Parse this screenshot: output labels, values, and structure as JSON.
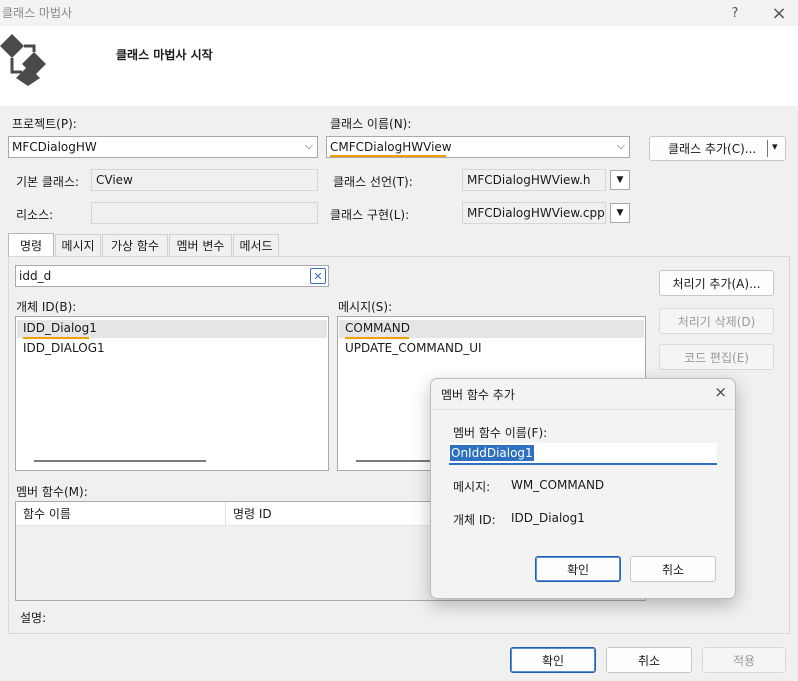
{
  "window": {
    "title": "클래스 마법사",
    "help": "?",
    "close": "×"
  },
  "banner": {
    "heading": "클래스 마법사 시작"
  },
  "project": {
    "label": "프로젝트(P):",
    "value": "MFCDialogHW"
  },
  "class_name": {
    "label": "클래스 이름(N):",
    "value": "CMFCDialogHWView"
  },
  "add_class_button": {
    "label": "클래스 추가(C)...",
    "arrow": "▾"
  },
  "base_class": {
    "label": "기본 클래스:",
    "value": "CView"
  },
  "resource": {
    "label": "리소스:",
    "value": ""
  },
  "class_decl": {
    "label": "클래스 선언(T):",
    "value": "MFCDialogHWView.h"
  },
  "class_impl": {
    "label": "클래스 구현(L):",
    "value": "MFCDialogHWView.cpp"
  },
  "tabs": [
    "명령",
    "메시지",
    "가상 함수",
    "멤버 변수",
    "메서드"
  ],
  "search": {
    "value": "idd_d"
  },
  "object_ids": {
    "label": "개체 ID(B):",
    "items": [
      "IDD_Dialog1",
      "IDD_DIALOG1"
    ]
  },
  "messages": {
    "label": "메시지(S):",
    "items": [
      "COMMAND",
      "UPDATE_COMMAND_UI"
    ]
  },
  "side_buttons": {
    "add_handler": "처리기 추가(A)...",
    "delete_handler": "처리기 삭제(D)",
    "edit_code": "코드 편집(E)"
  },
  "member_functions": {
    "label": "멤버 함수(M):",
    "columns": [
      "함수 이름",
      "명령 ID"
    ]
  },
  "description": {
    "label": "설명:"
  },
  "footer": {
    "ok": "확인",
    "cancel": "취소",
    "apply": "적용"
  },
  "dialog": {
    "title": "멤버 함수 추가",
    "close": "×",
    "name_label": "멤버 함수 이름(F):",
    "name_value": "OnIddDialog1",
    "message_label": "메시지:",
    "message_value": "WM_COMMAND",
    "object_label": "개체 ID:",
    "object_value": "IDD_Dialog1",
    "ok": "확인",
    "cancel": "취소"
  },
  "colors": {
    "accent": "#2f6fbf",
    "highlight_underline": "#f0a000"
  },
  "icons": {
    "wizard": "class-wizard-icon",
    "clear": "clear-search-icon",
    "dropdown": "chevron-down-icon"
  }
}
